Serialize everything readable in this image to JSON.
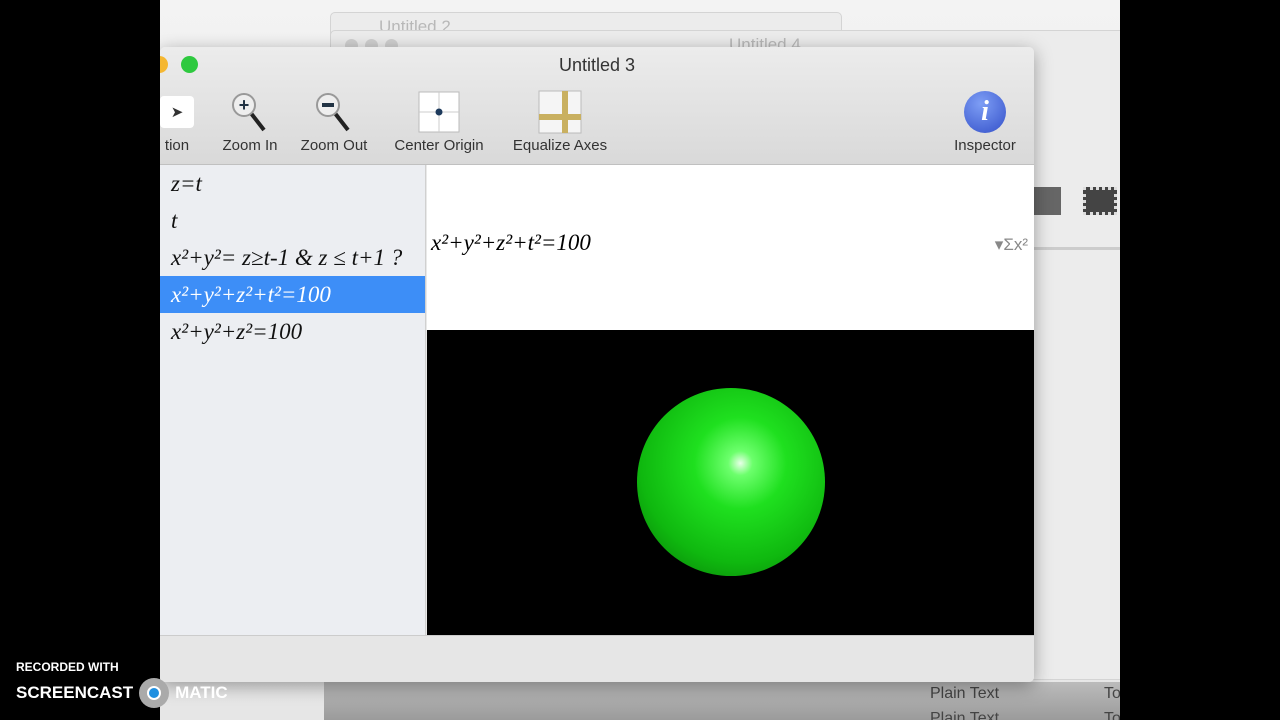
{
  "background_windows": [
    {
      "title": "Untitled 2"
    },
    {
      "title": "Untitled 4"
    }
  ],
  "background_list": [
    "Plain Text",
    "Plain Text",
    "To",
    "To"
  ],
  "window": {
    "title": "Untitled 3"
  },
  "toolbar": [
    {
      "label": "tion",
      "icon": "pointer-icon"
    },
    {
      "label": "Zoom In",
      "icon": "zoom-in-icon"
    },
    {
      "label": "Zoom Out",
      "icon": "zoom-out-icon"
    },
    {
      "label": "Center Origin",
      "icon": "center-origin-icon"
    },
    {
      "label": "Equalize Axes",
      "icon": "equalize-axes-icon"
    },
    {
      "label": "Inspector",
      "icon": "info-icon"
    }
  ],
  "equations": [
    "z=t",
    "t",
    "x²+y²= z≥t-1 & z ≤ t+1 ?",
    "x²+y²+z²+t²=100",
    "x²+y²+z²=100"
  ],
  "selected_index": 3,
  "editor": {
    "text": "x²+y²+z²+t²=100",
    "palette_icon": "▾Σx²"
  },
  "watermark": {
    "line1": "RECORDED WITH",
    "line2a": "SCREENCAST",
    "line2b": "MATIC"
  },
  "colors": {
    "selection": "#3d8ef7",
    "sphere": "#1fe01f"
  }
}
